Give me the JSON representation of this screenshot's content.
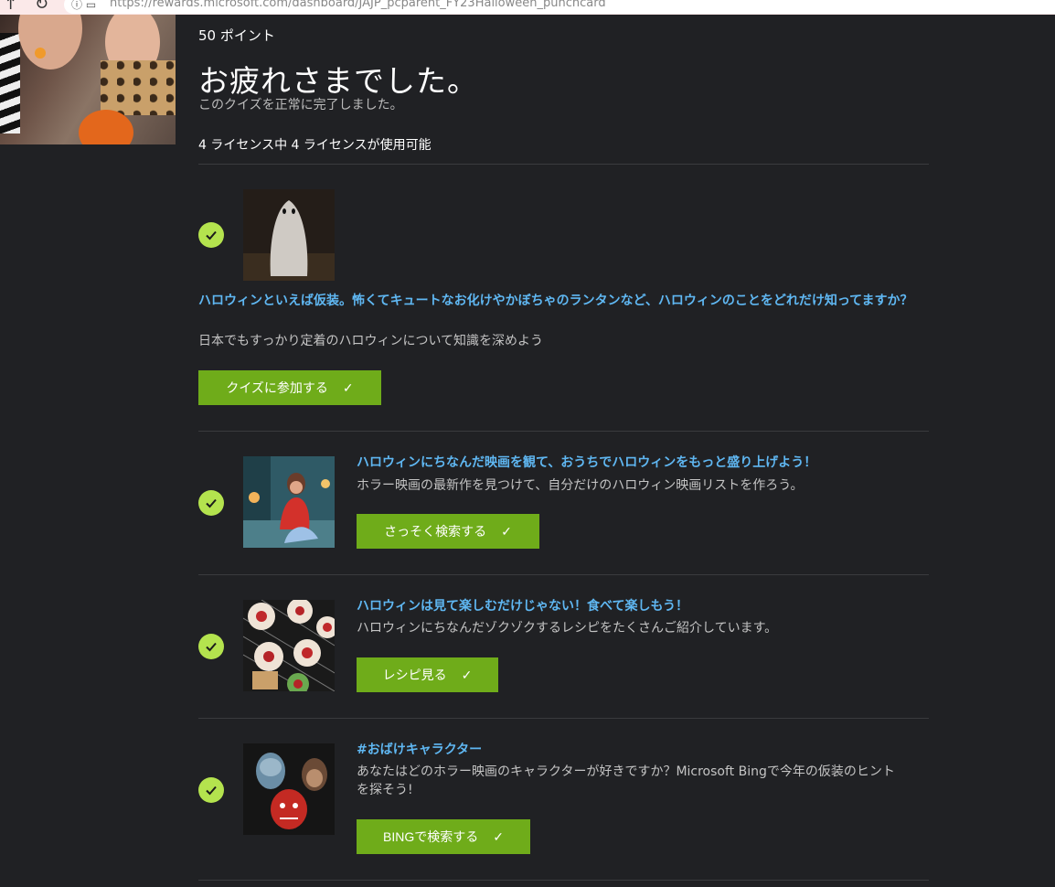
{
  "browser": {
    "url": "https://rewards.microsoft.com/dashboard/JAJP_pcparent_FY23Halloween_punchcard"
  },
  "header": {
    "points": "50 ポイント",
    "title": "お疲れさまでした。",
    "subtitle": "このクイズを正常に完了しました。",
    "licenses": "4 ライセンス中 4 ライセンスが使用可能"
  },
  "items": [
    {
      "title": "ハロウィンといえば仮装。怖くてキュートなお化けやかぼちゃのランタンなど、ハロウィンのことをどれだけ知ってますか？",
      "desc": "日本でもすっかり定着のハロウィンについて知識を深めよう",
      "button": "クイズに参加する",
      "thumb_icon": "ghost-image"
    },
    {
      "title": "ハロウィンにちなんだ映画を観て、おうちでハロウィンをもっと盛り上げよう！",
      "desc": "ホラー映画の最新作を見つけて、自分だけのハロウィン映画リストを作ろう。",
      "button": "さっそく検索する",
      "thumb_icon": "movie-watching-image"
    },
    {
      "title": "ハロウィンは見て楽しむだけじゃない！食べて楽しもう！",
      "desc": "ハロウィンにちなんだゾクゾクするレシピをたくさんご紹介しています。",
      "button": "レシピ見る",
      "thumb_icon": "cupcakes-image"
    },
    {
      "title": "#おばけキャラクター",
      "desc": "あなたはどのホラー映画のキャラクターが好きですか？Microsoft Bingで今年の仮装のヒントを探そう!",
      "button": "BINGで検索する",
      "thumb_icon": "horror-characters-image"
    }
  ],
  "colors": {
    "background": "#202124",
    "accent_green": "#6fac1a",
    "check_green": "#b4e34e",
    "link_blue": "#5fb7f2"
  }
}
